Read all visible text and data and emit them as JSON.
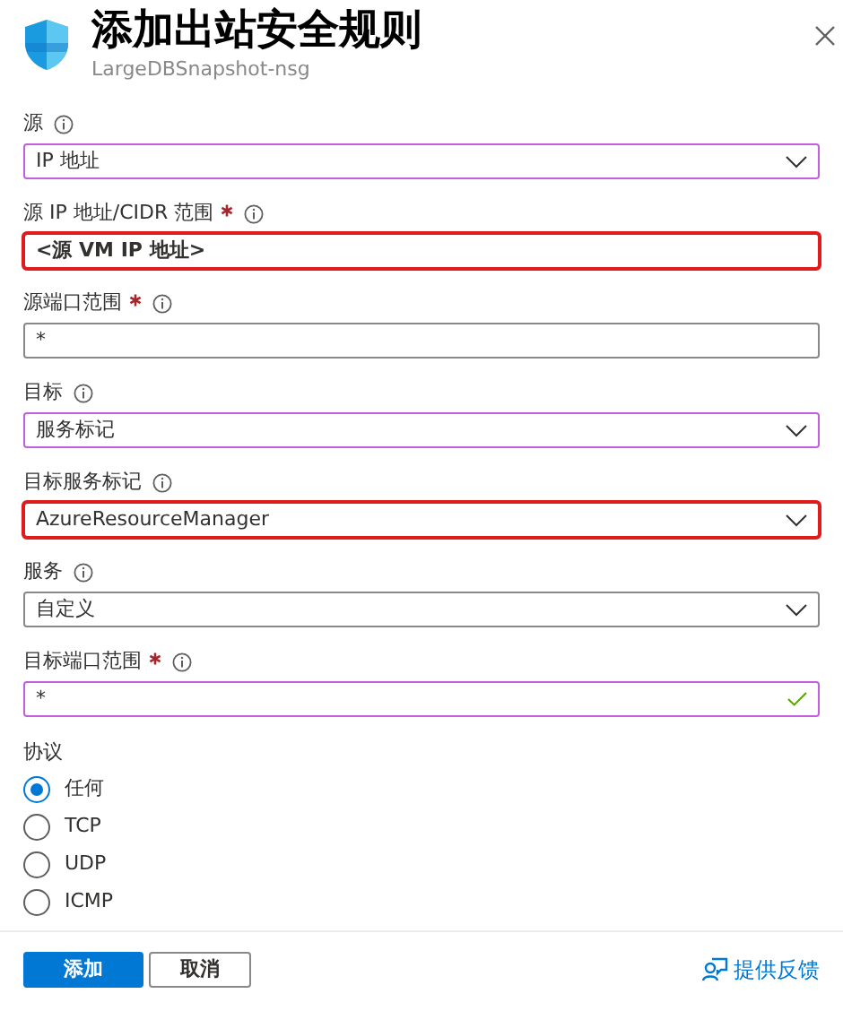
{
  "header": {
    "title": "添加出站安全规则",
    "subtitle": "LargeDBSnapshot-nsg"
  },
  "fields": [
    {
      "label": "源",
      "required": false,
      "kind": "select",
      "value": "IP 地址",
      "edited": true,
      "highlighted": false,
      "valid": false
    },
    {
      "label": "源 IP 地址/CIDR 范围",
      "required": true,
      "kind": "text",
      "value": "<源 VM IP 地址>",
      "edited": false,
      "highlighted": true,
      "valid": false
    },
    {
      "label": "源端口范围",
      "required": true,
      "kind": "text",
      "value": "*",
      "edited": false,
      "highlighted": false,
      "valid": false
    },
    {
      "label": "目标",
      "required": false,
      "kind": "select",
      "value": "服务标记",
      "edited": true,
      "highlighted": false,
      "valid": false
    },
    {
      "label": "目标服务标记",
      "required": false,
      "kind": "select",
      "value": "AzureResourceManager",
      "edited": true,
      "highlighted": true,
      "valid": false
    },
    {
      "label": "服务",
      "required": false,
      "kind": "select",
      "value": "自定义",
      "edited": false,
      "highlighted": false,
      "valid": false
    },
    {
      "label": "目标端口范围",
      "required": true,
      "kind": "text",
      "value": "*",
      "edited": true,
      "highlighted": false,
      "valid": true
    }
  ],
  "protocol": {
    "label": "协议",
    "options": [
      {
        "label": "任何",
        "selected": true
      },
      {
        "label": "TCP",
        "selected": false
      },
      {
        "label": "UDP",
        "selected": false
      },
      {
        "label": "ICMP",
        "selected": false
      }
    ]
  },
  "footer": {
    "buttons": [
      {
        "label": "添加",
        "kind": "primary"
      },
      {
        "label": "取消",
        "kind": "secondary"
      }
    ],
    "feedback": "提供反馈"
  }
}
